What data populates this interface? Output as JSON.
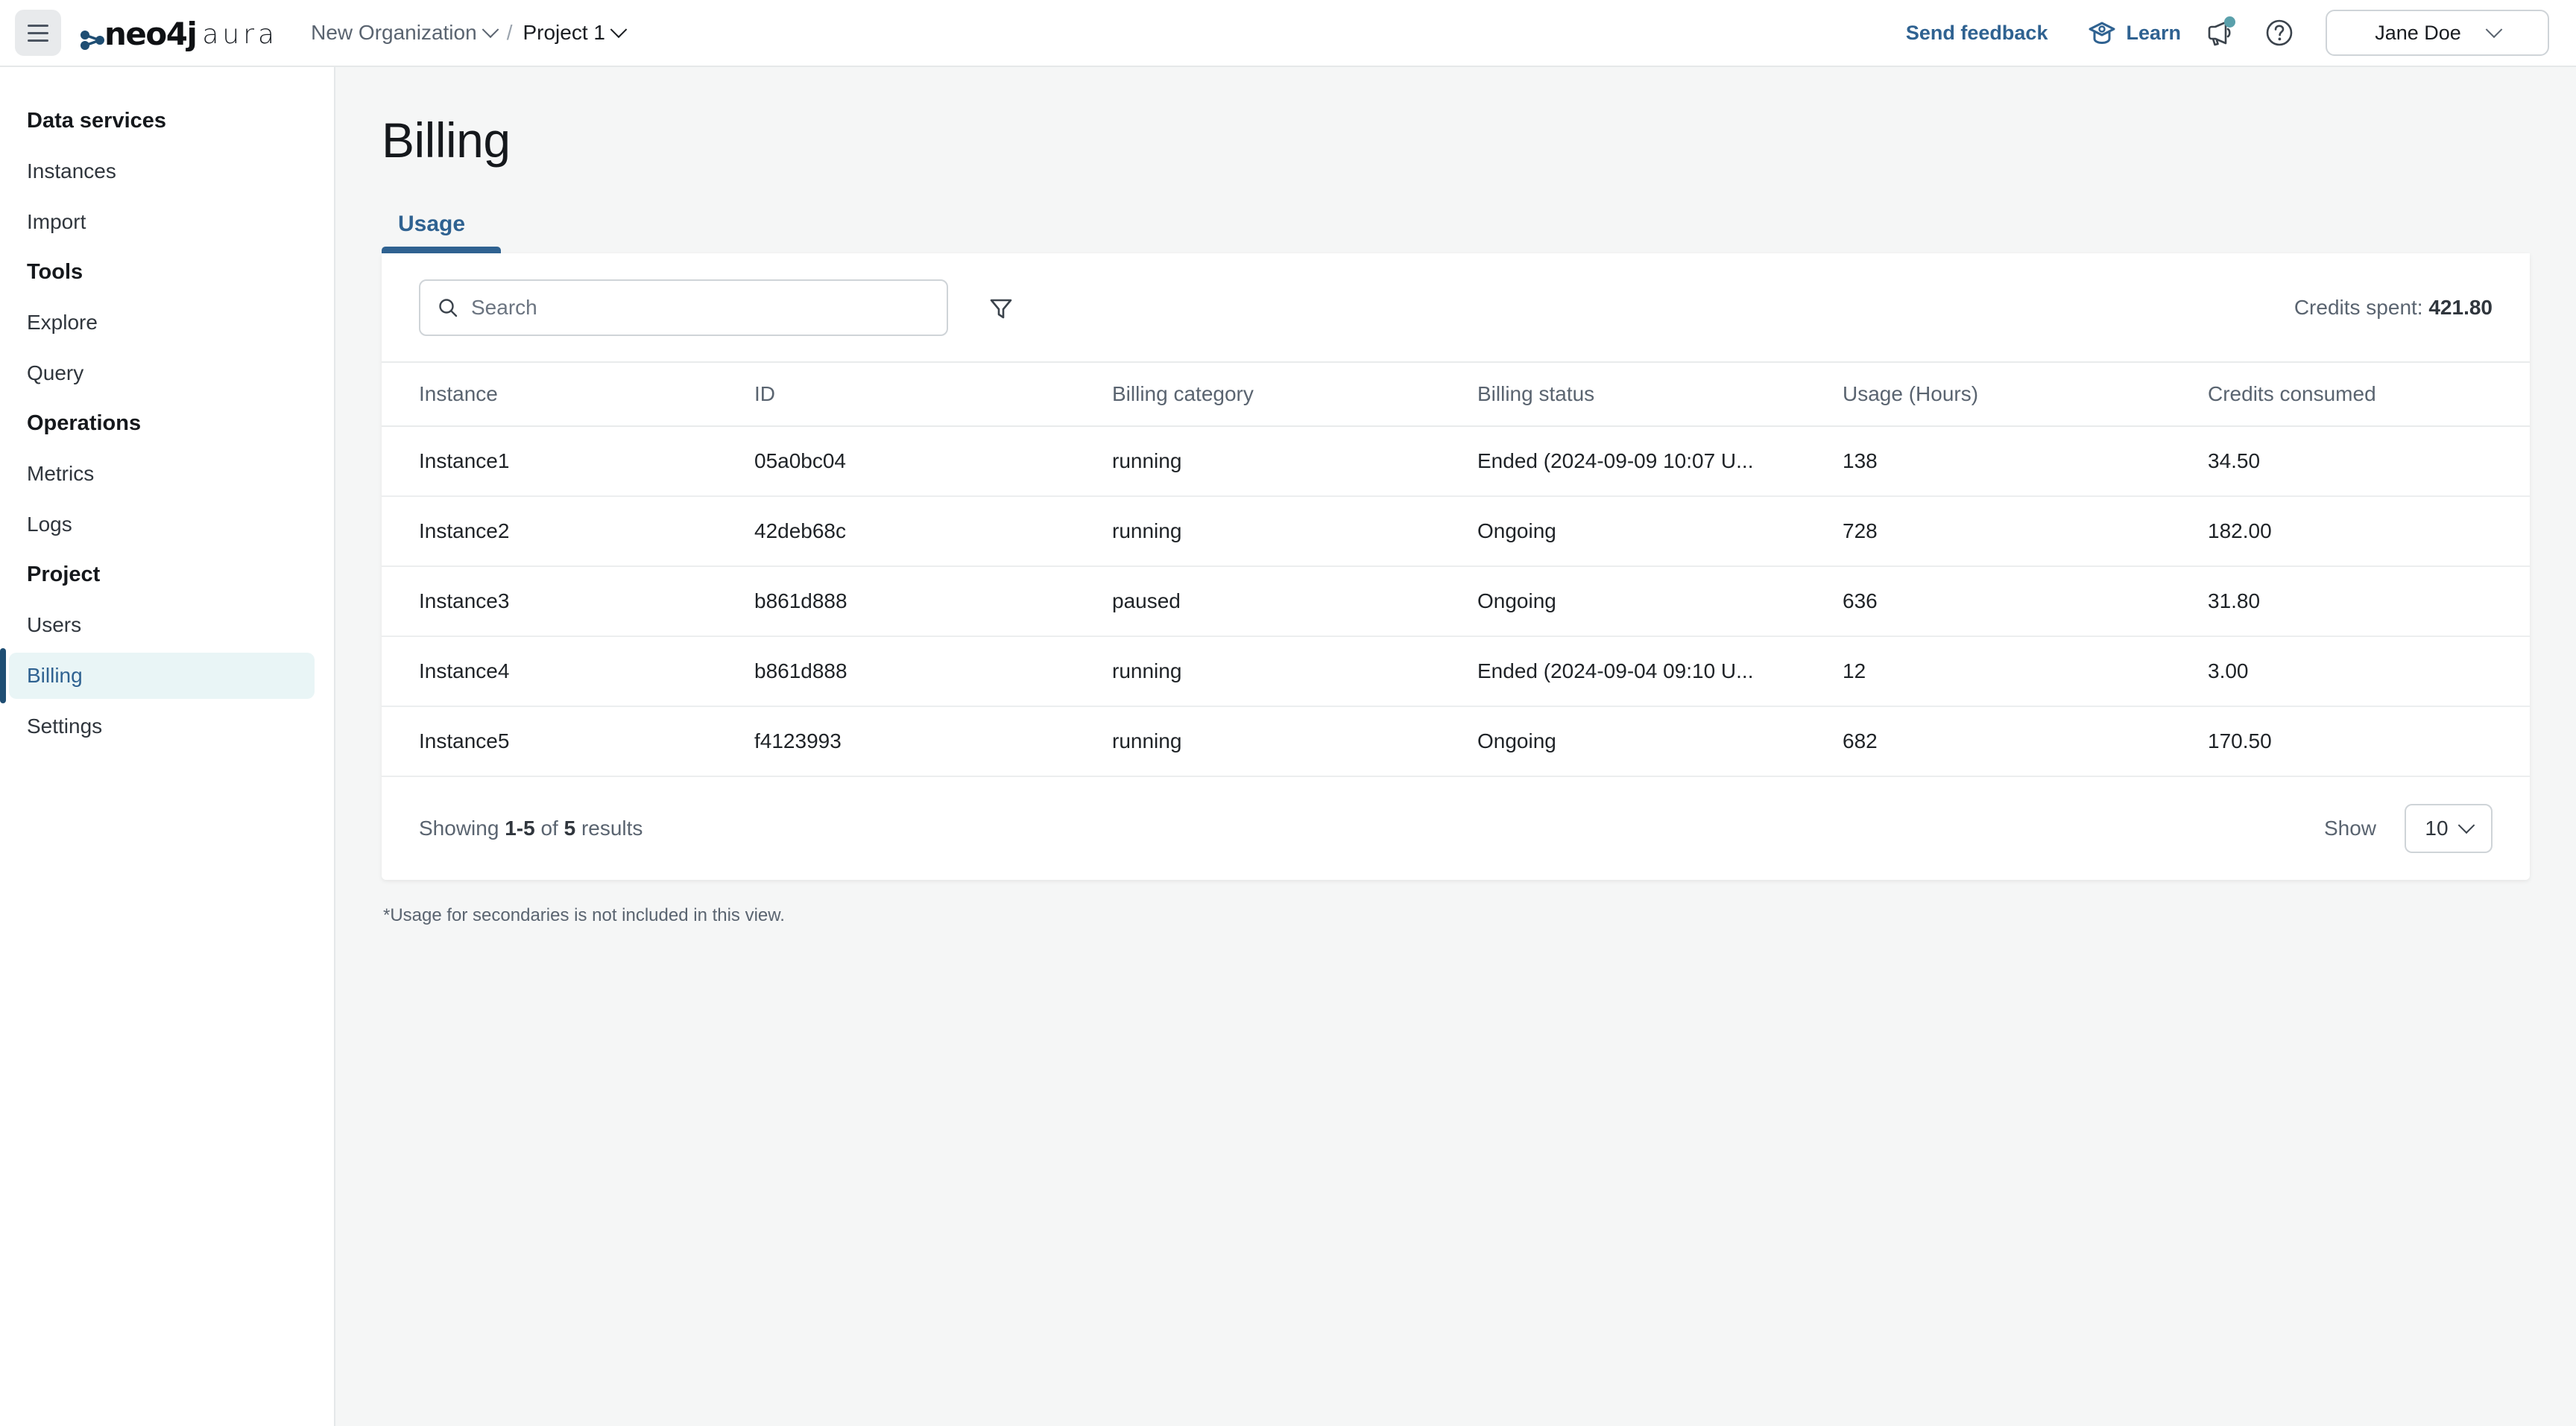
{
  "topbar": {
    "menu_icon": "hamburger-icon",
    "logo": {
      "brand": "neo4j",
      "product": "aura"
    },
    "breadcrumb": {
      "organization": "New Organization",
      "separator": "/",
      "project": "Project 1"
    },
    "send_feedback_label": "Send feedback",
    "learn_label": "Learn",
    "learn_icon": "graduation-cap-icon",
    "announcements_icon": "megaphone-icon",
    "help_icon": "question-circle-icon",
    "user_name": "Jane Doe",
    "accent_color": "#2f6291",
    "notification_dot_color": "#5aa0ab"
  },
  "sidebar": {
    "groups": [
      {
        "title": "Data services",
        "items": [
          {
            "label": "Instances",
            "active": false
          },
          {
            "label": "Import",
            "active": false
          }
        ]
      },
      {
        "title": "Tools",
        "items": [
          {
            "label": "Explore",
            "active": false
          },
          {
            "label": "Query",
            "active": false
          }
        ]
      },
      {
        "title": "Operations",
        "items": [
          {
            "label": "Metrics",
            "active": false
          },
          {
            "label": "Logs",
            "active": false
          }
        ]
      },
      {
        "title": "Project",
        "items": [
          {
            "label": "Users",
            "active": false
          },
          {
            "label": "Billing",
            "active": true
          },
          {
            "label": "Settings",
            "active": false
          }
        ]
      }
    ],
    "active_bg": "#e9f5f6",
    "active_accent": "#1f4e73"
  },
  "main": {
    "page_title": "Billing",
    "tabs": [
      {
        "label": "Usage",
        "active": true
      }
    ],
    "toolbar": {
      "search_placeholder": "Search",
      "search_value": "",
      "search_icon": "search-icon",
      "filter_icon": "filter-funnel-icon",
      "credits_spent_label": "Credits spent:",
      "credits_spent_value": "421.80"
    },
    "table": {
      "columns": [
        "Instance",
        "ID",
        "Billing category",
        "Billing status",
        "Usage (Hours)",
        "Credits consumed"
      ],
      "rows": [
        {
          "instance": "Instance1",
          "id": "05a0bc04",
          "category": "running",
          "status": "Ended (2024-09-09 10:07 U...",
          "usage": "138",
          "credits": "34.50"
        },
        {
          "instance": "Instance2",
          "id": "42deb68c",
          "category": "running",
          "status": "Ongoing",
          "usage": "728",
          "credits": "182.00"
        },
        {
          "instance": "Instance3",
          "id": "b861d888",
          "category": "paused",
          "status": "Ongoing",
          "usage": "636",
          "credits": "31.80"
        },
        {
          "instance": "Instance4",
          "id": "b861d888",
          "category": "running",
          "status": "Ended (2024-09-04 09:10 U...",
          "usage": "12",
          "credits": "3.00"
        },
        {
          "instance": "Instance5",
          "id": "f4123993",
          "category": "running",
          "status": "Ongoing",
          "usage": "682",
          "credits": "170.50"
        }
      ]
    },
    "footer": {
      "showing_prefix": "Showing",
      "showing_range": "1-5",
      "showing_of": "of",
      "showing_total": "5",
      "showing_suffix": "results",
      "show_label": "Show",
      "page_size": "10"
    },
    "footnote": "*Usage for secondaries is not included in this view."
  }
}
